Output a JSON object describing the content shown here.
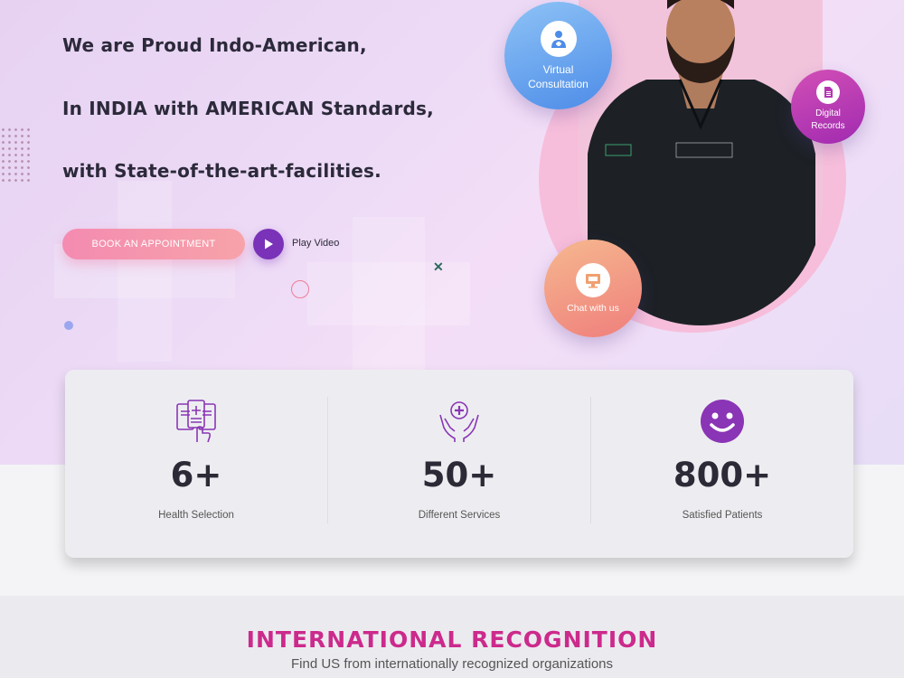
{
  "hero": {
    "line1": "We are Proud Indo-American,",
    "line2": "In INDIA with AMERICAN Standards,",
    "line3": "with State-of-the-art-facilities.",
    "book_label": "BOOK AN APPOINTMENT",
    "play_label": "Play Video"
  },
  "badges": {
    "virtual_line1": "Virtual",
    "virtual_line2": "Consultation",
    "digital_line1": "Digital",
    "digital_line2": "Records",
    "chat": "Chat with us"
  },
  "stats": [
    {
      "value": "6+",
      "label": "Health Selection",
      "icon": "medical-records-icon"
    },
    {
      "value": "50+",
      "label": "Different Services",
      "icon": "hands-care-icon"
    },
    {
      "value": "800+",
      "label": "Satisfied Patients",
      "icon": "smiley-icon"
    }
  ],
  "recognition": {
    "title": "INTERNATIONAL RECOGNITION",
    "subtitle": "Find US from internationally recognized organizations"
  },
  "colors": {
    "accent_purple": "#7a32b8",
    "accent_pink": "#cc2a8c",
    "button_pink": "#f48bb1"
  }
}
